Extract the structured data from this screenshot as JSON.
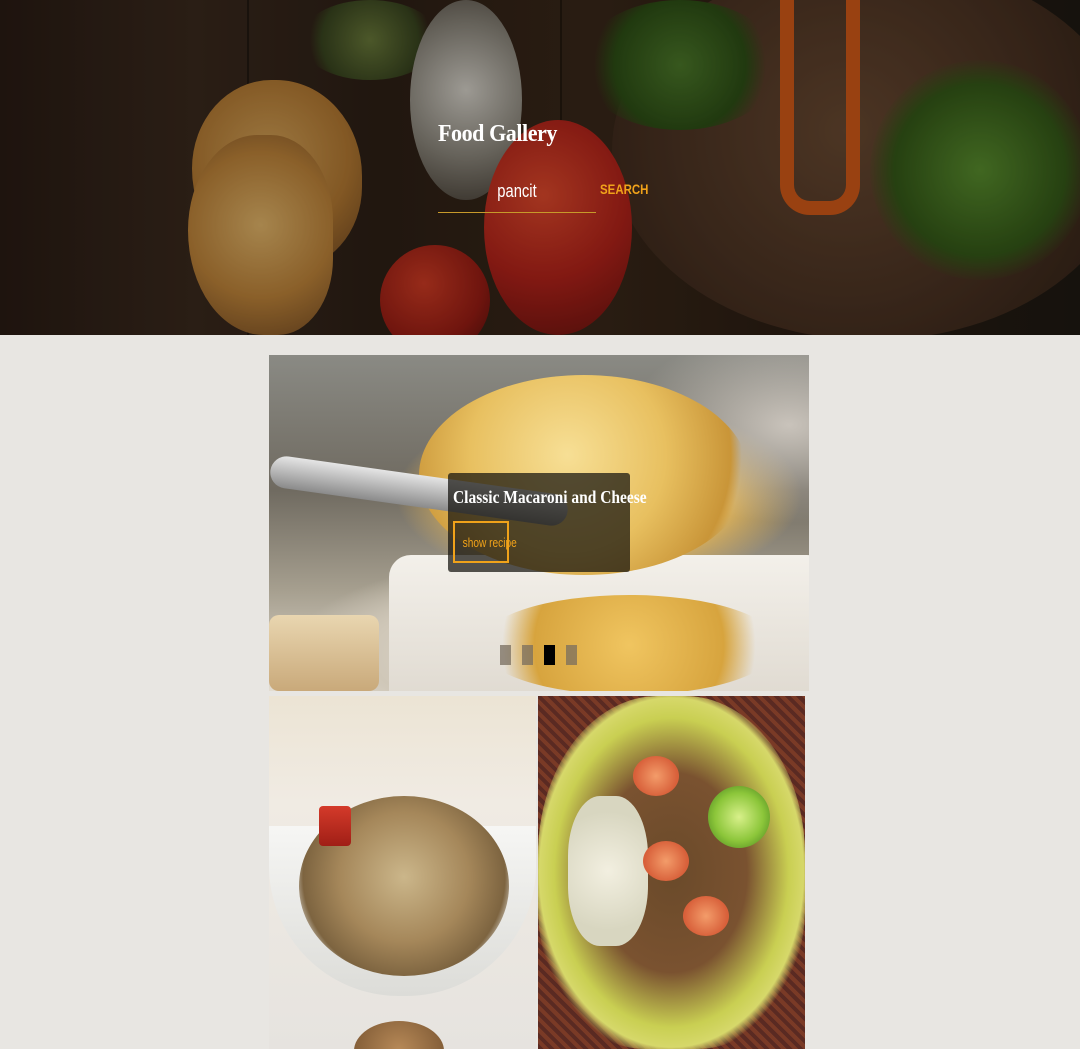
{
  "header": {
    "title": "Food Gallery",
    "search": {
      "value": "pancit",
      "button_label": "SEARCH"
    }
  },
  "carousel": {
    "slide": {
      "title": "Classic Macaroni and Cheese",
      "button_label": "show recipe"
    },
    "indicator_count": 4,
    "active_index": 2
  },
  "colors": {
    "accent": "#f0a21a",
    "page_background": "#e8e6e2"
  }
}
